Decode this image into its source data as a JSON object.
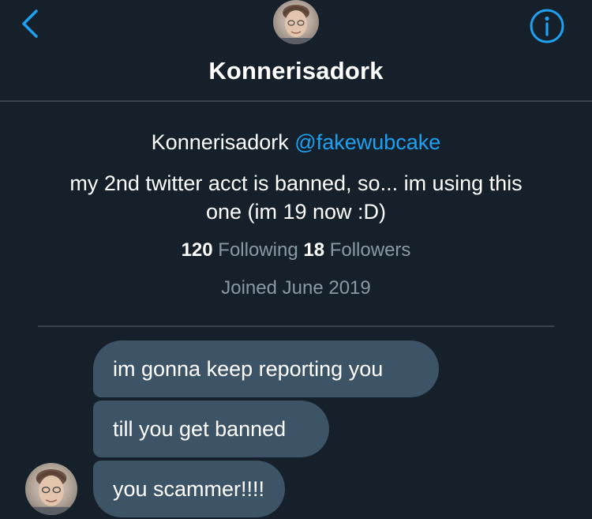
{
  "header": {
    "title": "Konnerisadork",
    "back_icon": "chevron-left-icon",
    "info_icon": "info-icon",
    "accent_color": "#1da1f2"
  },
  "profile": {
    "name": "Konnerisadork",
    "handle": "@fakewubcake",
    "bio": "my 2nd twitter acct is banned, so... im using this one (im 19 now :D)",
    "following_count": "120",
    "following_label": "Following",
    "followers_count": "18",
    "followers_label": "Followers",
    "joined": "Joined June 2019"
  },
  "messages": [
    {
      "text": "im gonna keep reporting you"
    },
    {
      "text": "till you get banned"
    },
    {
      "text": "you scammer!!!!"
    }
  ],
  "colors": {
    "background": "#15202b",
    "bubble": "#3d5466",
    "divider": "#38444d",
    "muted_text": "#8899a6"
  }
}
